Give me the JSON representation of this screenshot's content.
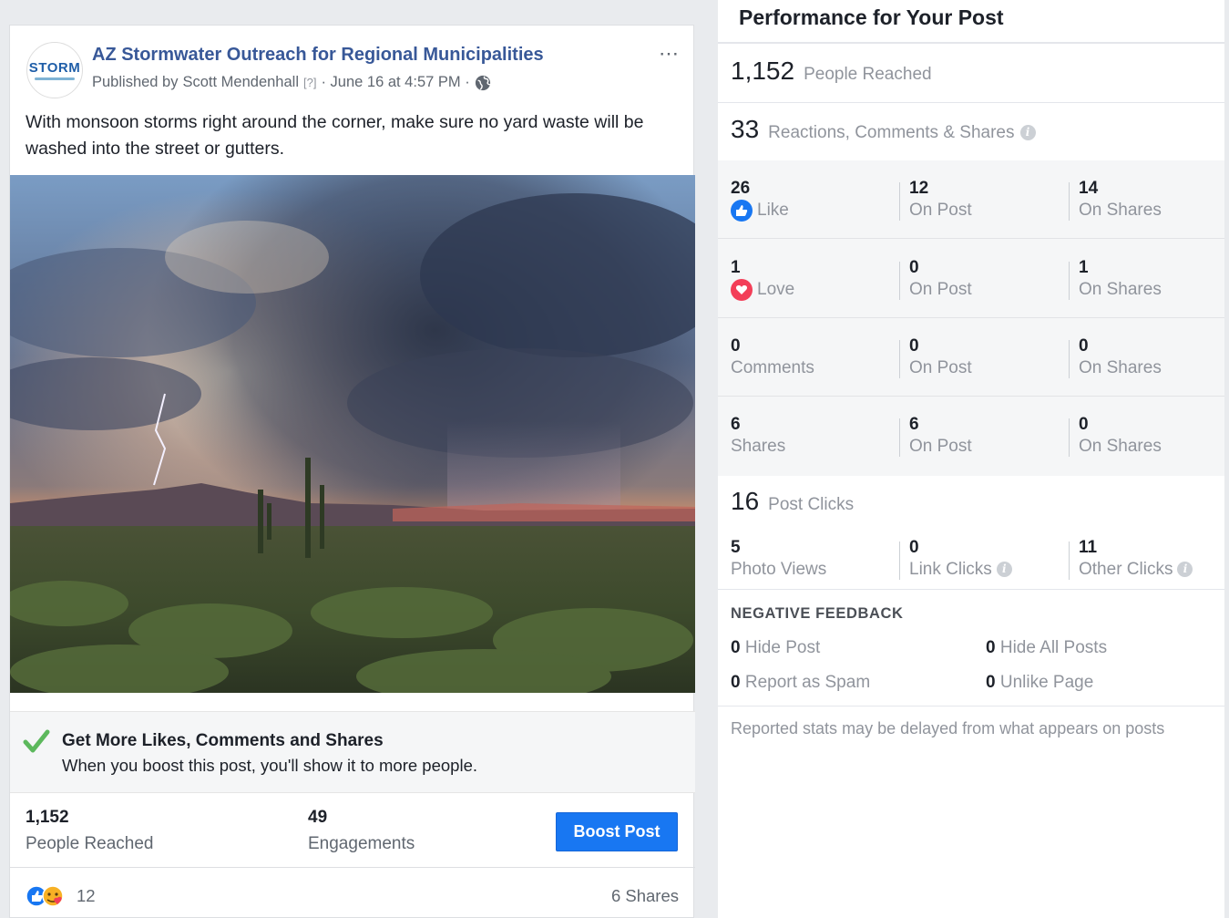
{
  "post": {
    "logo_text": "STORM",
    "page_name": "AZ Stormwater Outreach for Regional Municipalities",
    "published_prefix": "Published by",
    "publisher": "Scott Mendenhall",
    "help_mark": "[?]",
    "date": "· June 16 at 4:57 PM ·",
    "more_icon": "⋯",
    "text": "With monsoon storms right around the corner, make sure no yard waste will be washed into the street or gutters.",
    "boost_promo": {
      "title": "Get More Likes, Comments and Shares",
      "subtitle": "When you boost this post, you'll show it to more people."
    },
    "stats": {
      "reached_value": "1,152",
      "reached_label": "People Reached",
      "engagements_value": "49",
      "engagements_label": "Engagements"
    },
    "boost_button": "Boost Post",
    "reaction_count": "12",
    "shares_text": "6 Shares"
  },
  "panel": {
    "title": "Performance for Your Post",
    "people_reached": {
      "value": "1,152",
      "label": "People Reached"
    },
    "reactions_summary": {
      "value": "33",
      "label": "Reactions, Comments & Shares"
    },
    "rows": [
      {
        "total": "26",
        "label": "Like",
        "icon": "like-icon",
        "on_post": "12",
        "on_post_label": "On Post",
        "on_shares": "14",
        "on_shares_label": "On Shares"
      },
      {
        "total": "1",
        "label": "Love",
        "icon": "love-icon",
        "on_post": "0",
        "on_post_label": "On Post",
        "on_shares": "1",
        "on_shares_label": "On Shares"
      },
      {
        "total": "0",
        "label": "Comments",
        "icon": "",
        "on_post": "0",
        "on_post_label": "On Post",
        "on_shares": "0",
        "on_shares_label": "On Shares"
      },
      {
        "total": "6",
        "label": "Shares",
        "icon": "",
        "on_post": "6",
        "on_post_label": "On Post",
        "on_shares": "0",
        "on_shares_label": "On Shares"
      }
    ],
    "post_clicks": {
      "value": "16",
      "label": "Post Clicks"
    },
    "clicks": {
      "photo_views": {
        "value": "5",
        "label": "Photo Views"
      },
      "link_clicks": {
        "value": "0",
        "label": "Link Clicks"
      },
      "other_clicks": {
        "value": "11",
        "label": "Other Clicks"
      }
    },
    "negative_feedback": {
      "title": "NEGATIVE FEEDBACK",
      "hide_post": {
        "value": "0",
        "label": "Hide Post"
      },
      "hide_all": {
        "value": "0",
        "label": "Hide All Posts"
      },
      "report_spam": {
        "value": "0",
        "label": "Report as Spam"
      },
      "unlike_page": {
        "value": "0",
        "label": "Unlike Page"
      }
    },
    "disclaimer": "Reported stats may be delayed from what appears on posts"
  },
  "colors": {
    "link_blue": "#385898",
    "boost_blue": "#1877f2",
    "love_red": "#f33e58",
    "muted_text": "#90949c",
    "check_green": "#5cb85c"
  }
}
